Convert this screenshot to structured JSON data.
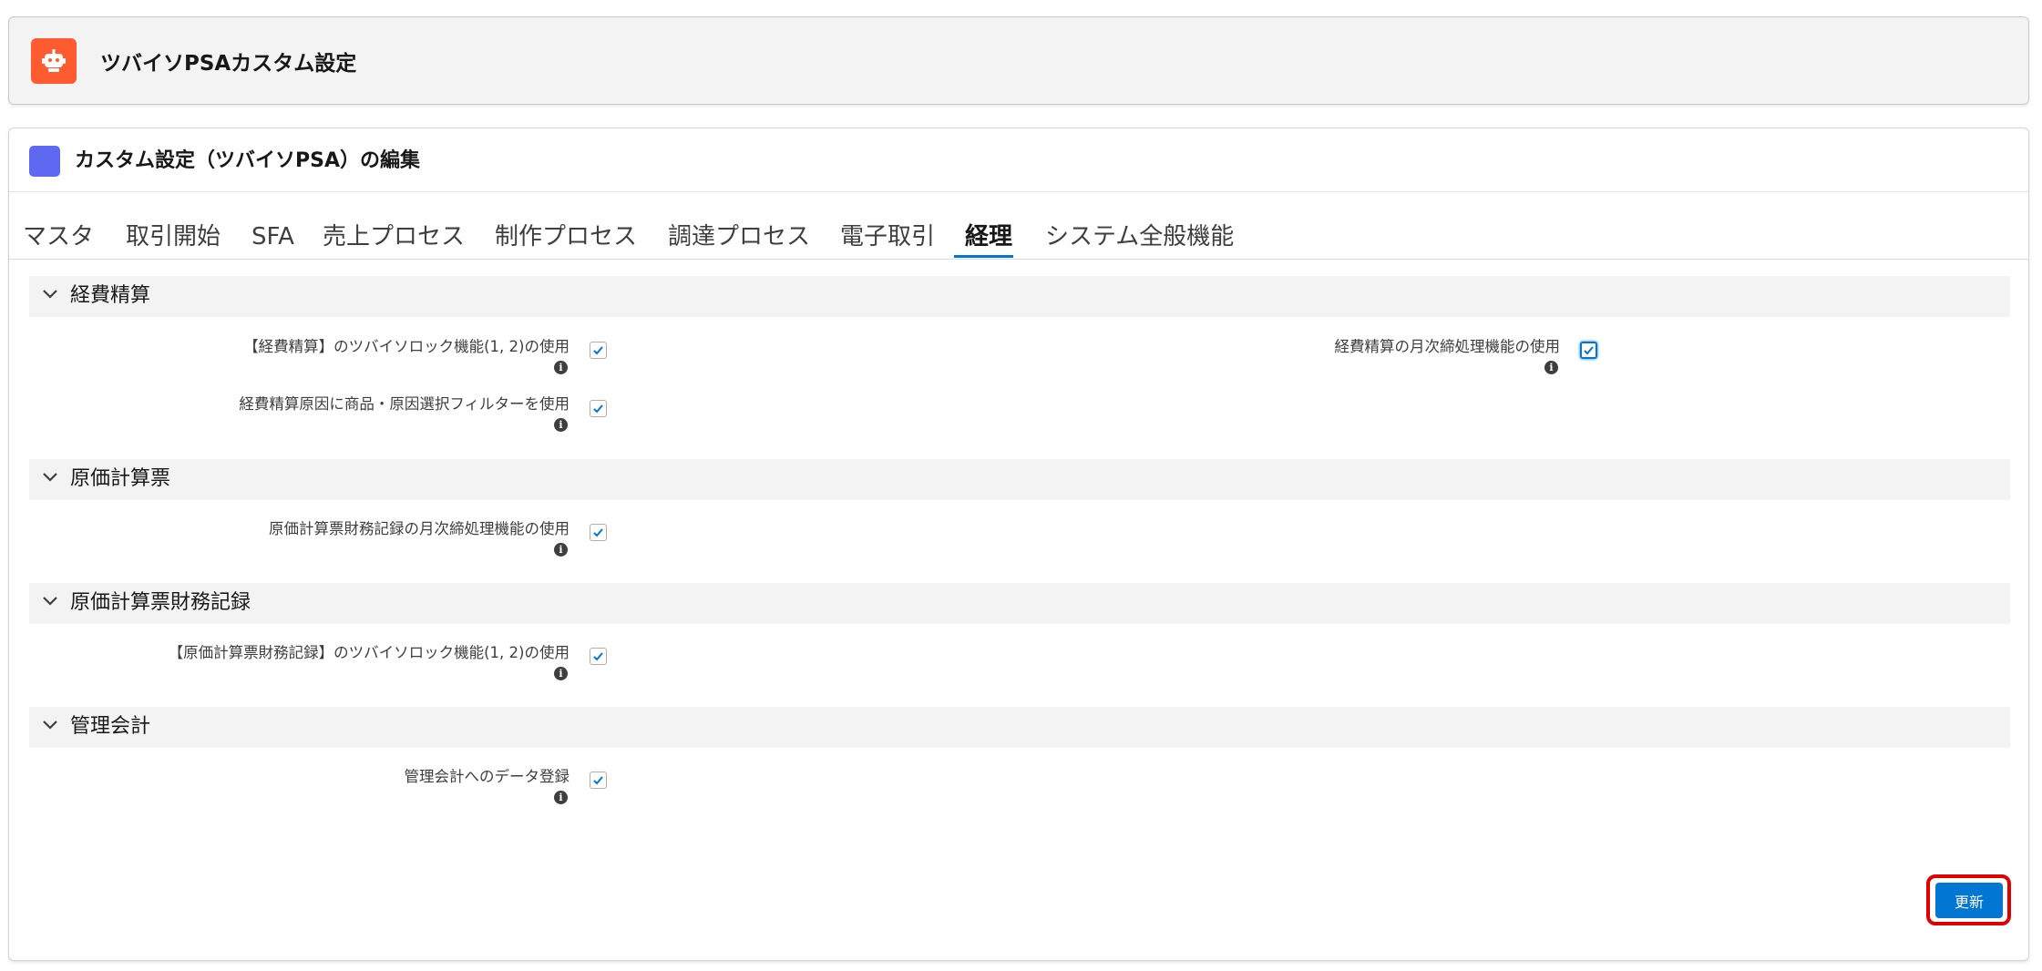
{
  "header": {
    "title": "ツバイソPSAカスタム設定",
    "icon": "robot-icon"
  },
  "card": {
    "title": "カスタム設定（ツバイソPSA）の編集"
  },
  "tabs": [
    {
      "label": "マスタ"
    },
    {
      "label": "取引開始"
    },
    {
      "label": "SFA"
    },
    {
      "label": "売上プロセス"
    },
    {
      "label": "制作プロセス"
    },
    {
      "label": "調達プロセス"
    },
    {
      "label": "電子取引"
    },
    {
      "label": "経理",
      "active": true
    },
    {
      "label": "システム全般機能"
    }
  ],
  "sections": [
    {
      "title": "経費精算",
      "fields": [
        {
          "label": "【経費精算】のツバイソロック機能(1, 2)の使用",
          "checked": true
        },
        {
          "label": "経費精算原因に商品・原因選択フィルターを使用",
          "checked": true
        },
        {
          "label": "経費精算の月次締処理機能の使用",
          "checked": true
        }
      ]
    },
    {
      "title": "原価計算票",
      "fields": [
        {
          "label": "原価計算票財務記録の月次締処理機能の使用",
          "checked": true
        }
      ]
    },
    {
      "title": "原価計算票財務記録",
      "fields": [
        {
          "label": "【原価計算票財務記録】のツバイソロック機能(1, 2)の使用",
          "checked": true
        }
      ]
    },
    {
      "title": "管理会計",
      "fields": [
        {
          "label": "管理会計へのデータ登録",
          "checked": true
        }
      ]
    }
  ],
  "update_button": {
    "label": "更新"
  },
  "colors": {
    "accent": "#0176d3",
    "app_icon_bg": "#fe5c30",
    "card_icon_bg": "#5d69f0",
    "highlight": "#e00000"
  }
}
